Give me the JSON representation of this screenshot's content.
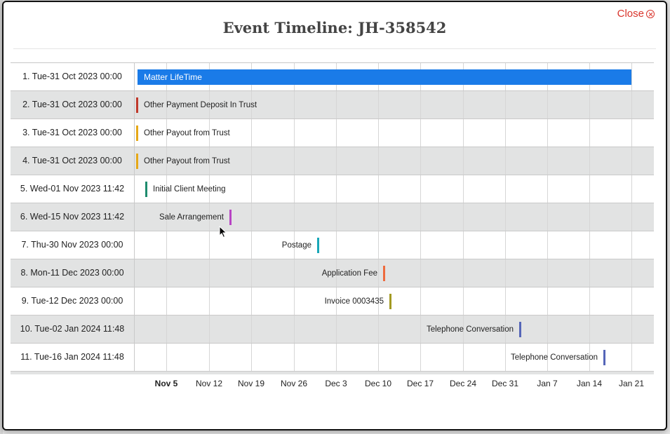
{
  "modal": {
    "title": "Event Timeline: JH-358542",
    "close_label": "Close"
  },
  "timeline": {
    "events": [
      {
        "label": "1. Tue-31 Oct 2023 00:00",
        "name": "Matter LifeTime",
        "color": "#1a7be8"
      },
      {
        "label": "2. Tue-31 Oct 2023 00:00",
        "name": "Other Payment Deposit In Trust",
        "color": "#c0392b"
      },
      {
        "label": "3. Tue-31 Oct 2023 00:00",
        "name": "Other Payout from Trust",
        "color": "#e6a817"
      },
      {
        "label": "4. Tue-31 Oct 2023 00:00",
        "name": "Other Payout from Trust",
        "color": "#e6a817"
      },
      {
        "label": "5. Wed-01 Nov 2023 11:42",
        "name": "Initial Client Meeting",
        "color": "#1e8c6e"
      },
      {
        "label": "6. Wed-15 Nov 2023 11:42",
        "name": "Sale Arrangement",
        "color": "#b844c4"
      },
      {
        "label": "7. Thu-30 Nov 2023 00:00",
        "name": "Postage",
        "color": "#19a7b8"
      },
      {
        "label": "8. Mon-11 Dec 2023 00:00",
        "name": "Application Fee",
        "color": "#ee6b3e"
      },
      {
        "label": "9. Tue-12 Dec 2023 00:00",
        "name": "Invoice 0003435",
        "color": "#a39a22"
      },
      {
        "label": "10. Tue-02 Jan 2024 11:48",
        "name": "Telephone Conversation",
        "color": "#5566b8"
      },
      {
        "label": "11. Tue-16 Jan 2024 11:48",
        "name": "Telephone Conversation",
        "color": "#5566b8"
      }
    ],
    "axis_ticks": [
      "Nov 5",
      "Nov 12",
      "Nov 19",
      "Nov 26",
      "Dec 3",
      "Dec 10",
      "Dec 17",
      "Dec 24",
      "Dec 31",
      "Jan 7",
      "Jan 14",
      "Jan 21"
    ],
    "bold_tick": "Nov 5"
  }
}
